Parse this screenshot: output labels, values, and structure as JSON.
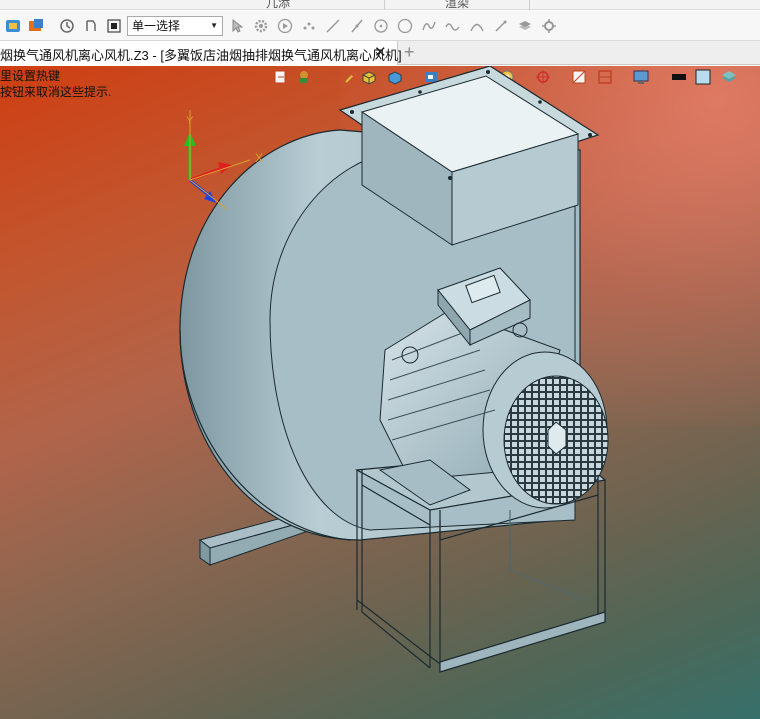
{
  "ribbon": {
    "groups": [
      {
        "label": "几添"
      },
      {
        "label": "渲染"
      }
    ]
  },
  "toolbar": {
    "filter_value": "单一选择",
    "icons": [
      "app-icon",
      "script-icon",
      "undo-icon",
      "redo-icon",
      "stop-icon",
      "cursor-icon",
      "gear-icon",
      "play-icon",
      "point-icon",
      "line-icon",
      "slash-icon",
      "circle-icon",
      "curve-icon",
      "wave-icon",
      "arc-icon",
      "pen-icon",
      "settings-icon"
    ]
  },
  "document": {
    "tab_title": "烟换气通风机离心风机.Z3 - [多翼饭店油烟抽排烟换气通风机离心风机]",
    "close_glyph": "✕",
    "add_glyph": "+"
  },
  "viewport": {
    "hint_line1": "里设置热键",
    "hint_line2": "按钮来取消这些提示.",
    "axis_x_label": "X",
    "axis_y_label": "Y",
    "colors": {
      "model": "#b9cdd4",
      "model_dark": "#8fa9b2",
      "edge": "#1b2a30",
      "axis_x": "#e02020",
      "axis_y": "#20c020",
      "axis_z": "#2040e0"
    }
  }
}
